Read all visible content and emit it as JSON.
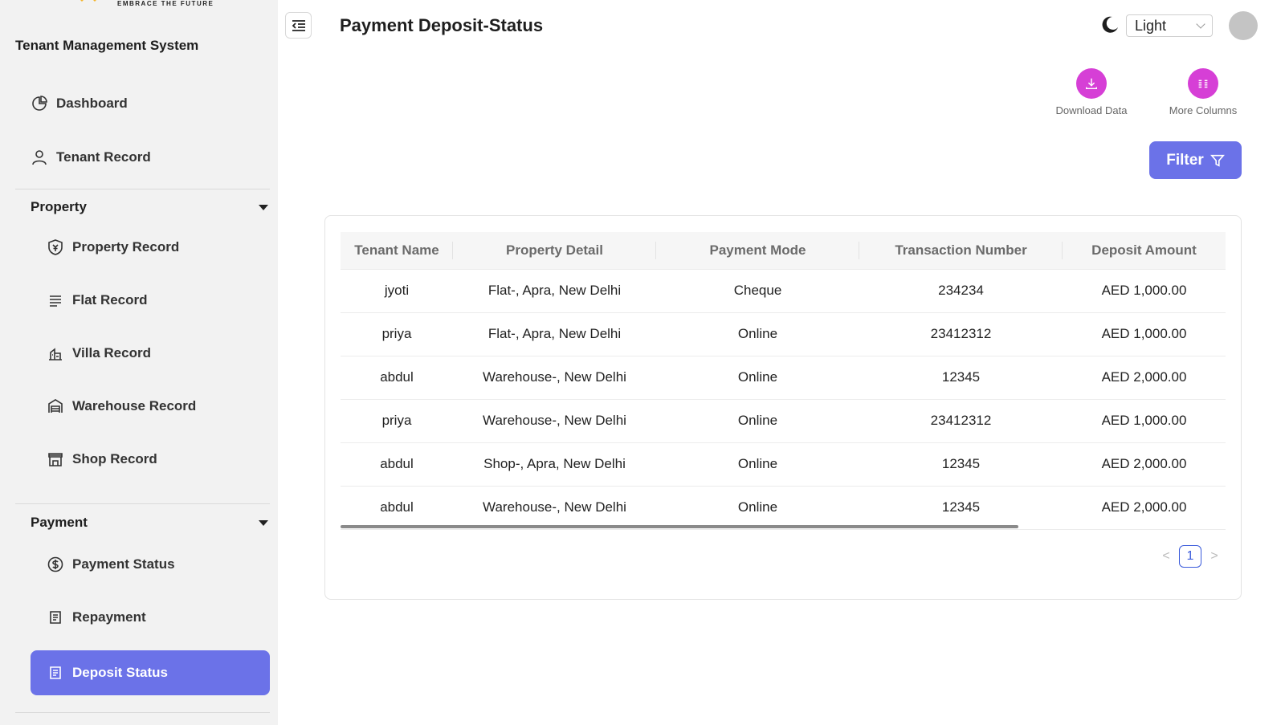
{
  "brand": {
    "tagline": "EMBRACE THE FUTURE",
    "app_title": "Tenant Management System"
  },
  "sidebar": {
    "dashboard": "Dashboard",
    "tenant_record": "Tenant Record",
    "property_section": "Property",
    "property_items": [
      "Property Record",
      "Flat Record",
      "Villa Record",
      "Warehouse Record",
      "Shop Record"
    ],
    "payment_section": "Payment",
    "payment_items": [
      "Payment Status",
      "Repayment",
      "Deposit Status"
    ],
    "active_item": "Deposit Status"
  },
  "header": {
    "title": "Payment Deposit-Status",
    "theme_value": "Light"
  },
  "actions": {
    "download": "Download Data",
    "more_columns": "More Columns",
    "filter": "Filter"
  },
  "table": {
    "columns": [
      "Tenant Name",
      "Property Detail",
      "Payment Mode",
      "Transaction Number",
      "Deposit Amount"
    ],
    "rows": [
      [
        "jyoti",
        "Flat-, Apra, New Delhi",
        "Cheque",
        "234234",
        "AED 1,000.00"
      ],
      [
        "priya",
        "Flat-, Apra, New Delhi",
        "Online",
        "23412312",
        "AED 1,000.00"
      ],
      [
        "abdul",
        "Warehouse-, New Delhi",
        "Online",
        "12345",
        "AED 2,000.00"
      ],
      [
        "priya",
        "Warehouse-, New Delhi",
        "Online",
        "23412312",
        "AED 1,000.00"
      ],
      [
        "abdul",
        "Shop-, Apra, New Delhi",
        "Online",
        "12345",
        "AED 2,000.00"
      ],
      [
        "abdul",
        "Warehouse-, New Delhi",
        "Online",
        "12345",
        "AED 2,000.00"
      ]
    ]
  },
  "pagination": {
    "current": "1",
    "prev": "<",
    "next": ">"
  },
  "colors": {
    "accent": "#6b72e8",
    "action": "#d63fd6",
    "sidebar_bg": "#f2f2f2"
  }
}
